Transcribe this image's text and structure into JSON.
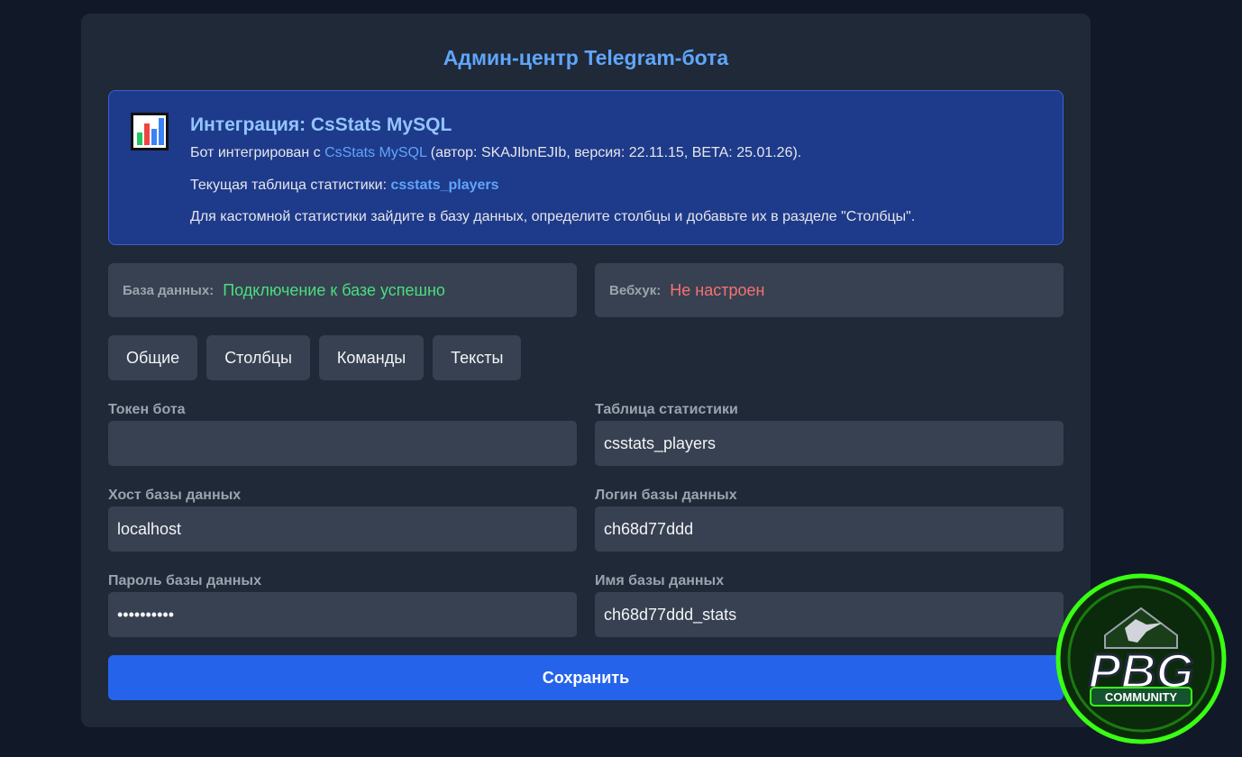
{
  "header": {
    "title": "Админ-центр Telegram-бота"
  },
  "integration": {
    "icon": "bar-chart-icon",
    "title": "Интеграция: CsStats MySQL",
    "line1_prefix": "Бот интегрирован с",
    "line1_link": "CsStats MySQL",
    "line1_suffix": "(автор: SKAJIbnEJIb, версия: 22.11.15, BETA: 25.01.26).",
    "line2_prefix": "Текущая таблица статистики:",
    "line2_value": "csstats_players",
    "line3": "Для кастомной статистики зайдите в базу данных, определите столбцы и добавьте их в разделе \"Столбцы\"."
  },
  "status": {
    "database_label": "База данных:",
    "database_value": "Подключение к базе успешно",
    "webhook_label": "Вебхук:",
    "webhook_value": "Не настроен"
  },
  "tabs": [
    {
      "label": "Общие"
    },
    {
      "label": "Столбцы"
    },
    {
      "label": "Команды"
    },
    {
      "label": "Тексты"
    }
  ],
  "form": {
    "bot_token": {
      "label": "Токен бота",
      "value": ""
    },
    "stats_table": {
      "label": "Таблица статистики",
      "value": "csstats_players"
    },
    "db_host": {
      "label": "Хост базы данных",
      "value": "localhost"
    },
    "db_login": {
      "label": "Логин базы данных",
      "value": "ch68d77ddd"
    },
    "db_password": {
      "label": "Пароль базы данных",
      "value": "••••••••••"
    },
    "db_name": {
      "label": "Имя базы данных",
      "value": "ch68d77ddd_stats"
    }
  },
  "save_label": "Сохранить",
  "logo": {
    "main": "PBG",
    "sub": "COMMUNITY"
  },
  "colors": {
    "accent": "#2563eb",
    "title": "#60a5fa",
    "success": "#4ade80",
    "error": "#f87171",
    "logo_green": "#39ff14"
  }
}
